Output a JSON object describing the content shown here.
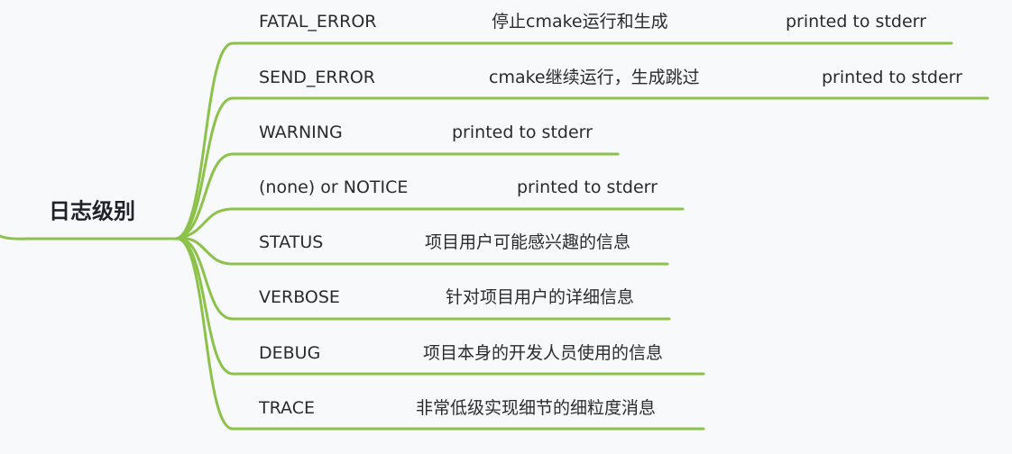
{
  "root": {
    "label": "日志级别"
  },
  "line_color": "#8dc24a",
  "branches": [
    {
      "label": "FATAL_ERROR",
      "desc": "停止cmake运行和生成",
      "extra": "printed to stderr"
    },
    {
      "label": "SEND_ERROR",
      "desc": "cmake继续运行，生成跳过",
      "extra": "printed to stderr"
    },
    {
      "label": "WARNING",
      "desc": "printed to stderr"
    },
    {
      "label": "(none) or NOTICE",
      "desc": "printed to stderr"
    },
    {
      "label": "STATUS",
      "desc": "项目用户可能感兴趣的信息"
    },
    {
      "label": "VERBOSE",
      "desc": "针对项目用户的详细信息"
    },
    {
      "label": "DEBUG",
      "desc": "项目本身的开发人员使用的信息"
    },
    {
      "label": "TRACE",
      "desc": "非常低级实现细节的细粒度消息"
    }
  ]
}
